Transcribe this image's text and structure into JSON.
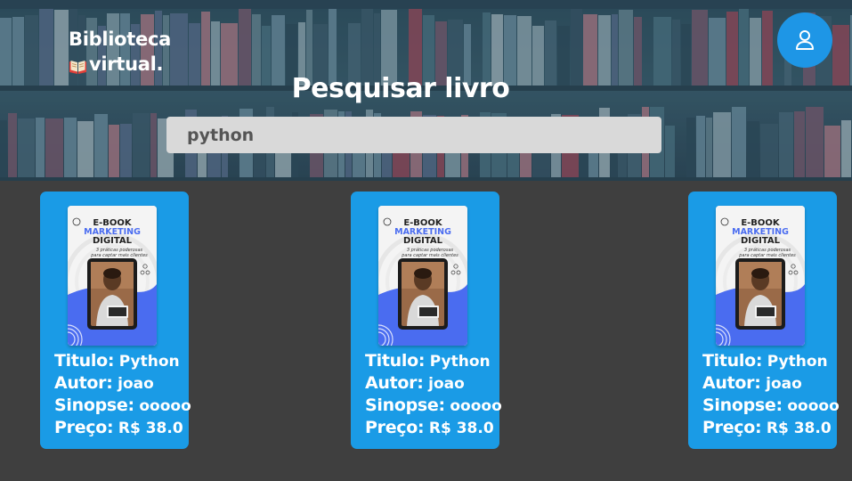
{
  "header": {
    "logo_line1": "Biblioteca",
    "logo_line2": "virtual.",
    "logo_icon": "open-book-icon",
    "user_icon": "user-icon",
    "title": "Pesquisar livro"
  },
  "search": {
    "value": "python"
  },
  "cover": {
    "line1": "E-BOOK",
    "line2": "MARKETING",
    "line3": "DIGITAL",
    "line4": "3 práticas poderosas",
    "line5": "para captar mais clientes"
  },
  "cards": [
    {
      "title_label": "Titulo:",
      "title": "Python",
      "author_label": "Autor:",
      "author": "joao",
      "synopsis_label": "Sinopse:",
      "synopsis": "ooooo",
      "price_label": "Preço:",
      "price": "R$ 38.0"
    },
    {
      "title_label": "Titulo:",
      "title": "Python",
      "author_label": "Autor:",
      "author": "joao",
      "synopsis_label": "Sinopse:",
      "synopsis": "ooooo",
      "price_label": "Preço:",
      "price": "R$ 38.0"
    },
    {
      "title_label": "Titulo:",
      "title": "Python",
      "author_label": "Autor:",
      "author": "joao",
      "synopsis_label": "Sinopse:",
      "synopsis": "ooooo",
      "price_label": "Preço:",
      "price": "R$ 38.0"
    }
  ],
  "colors": {
    "card": "#1a9be6",
    "accent": "#1e96e6",
    "background": "#3f3f3f",
    "search_bg": "#d9d9d9"
  }
}
